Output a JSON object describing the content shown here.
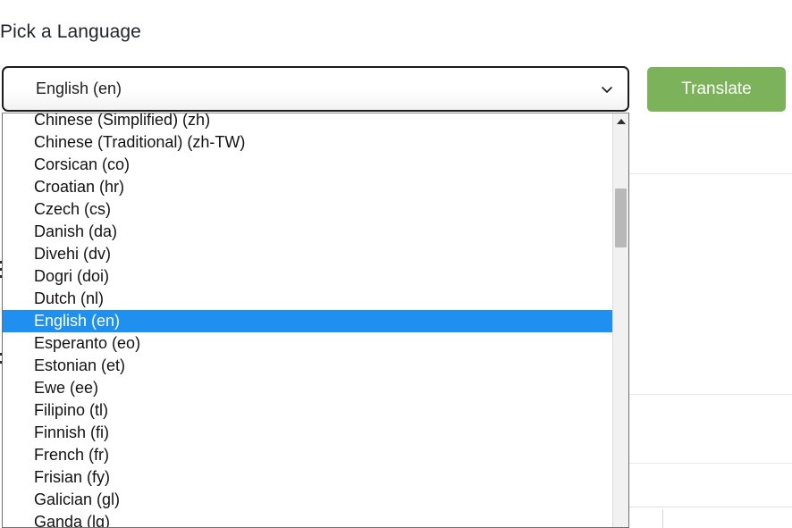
{
  "page": {
    "title": "Pick a Language"
  },
  "language_select": {
    "name": "language-select",
    "selected_value": "English (en)",
    "expanded": true,
    "arrow_icon": "chevron-down-icon",
    "options": [
      "Chinese (Simplified) (zh)",
      "Chinese (Traditional) (zh-TW)",
      "Corsican (co)",
      "Croatian (hr)",
      "Czech (cs)",
      "Danish (da)",
      "Divehi (dv)",
      "Dogri (doi)",
      "Dutch (nl)",
      "English (en)",
      "Esperanto (eo)",
      "Estonian (et)",
      "Ewe (ee)",
      "Filipino (tl)",
      "Finnish (fi)",
      "French (fr)",
      "Frisian (fy)",
      "Galician (gl)",
      "Ganda (lg)"
    ],
    "selected_index": 9
  },
  "scrollbar": {
    "up_arrow_icon": "triangle-up-icon",
    "thumb_label": "scroll-thumb"
  },
  "actions": {
    "translate_label": "Translate"
  },
  "colors": {
    "highlight": "#2090f0",
    "translate_button": "#7cb35a",
    "select_border": "#1b1b1b",
    "text": "#121212"
  }
}
